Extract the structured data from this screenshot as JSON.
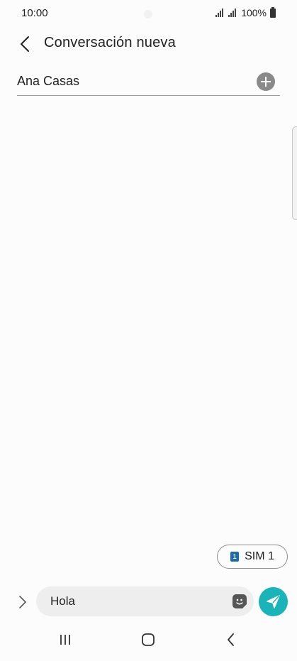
{
  "status_bar": {
    "time": "10:00",
    "battery_text": "100%"
  },
  "header": {
    "back_icon": "chevron-left-icon",
    "title": "Conversación nueva"
  },
  "recipient": {
    "name": "Ana Casas",
    "add_icon": "plus-circle-icon"
  },
  "sim_selector": {
    "badge": "1",
    "label": "SIM 1",
    "badge_color": "#1a6da8"
  },
  "composer": {
    "expand_icon": "chevron-right-icon",
    "message_value": "Hola",
    "sticker_icon": "sticker-icon",
    "send_icon": "send-icon",
    "send_color": "#19b3b8"
  },
  "nav_bar": {
    "recents_icon": "recents-icon",
    "home_icon": "home-icon",
    "back_icon": "back-icon"
  }
}
